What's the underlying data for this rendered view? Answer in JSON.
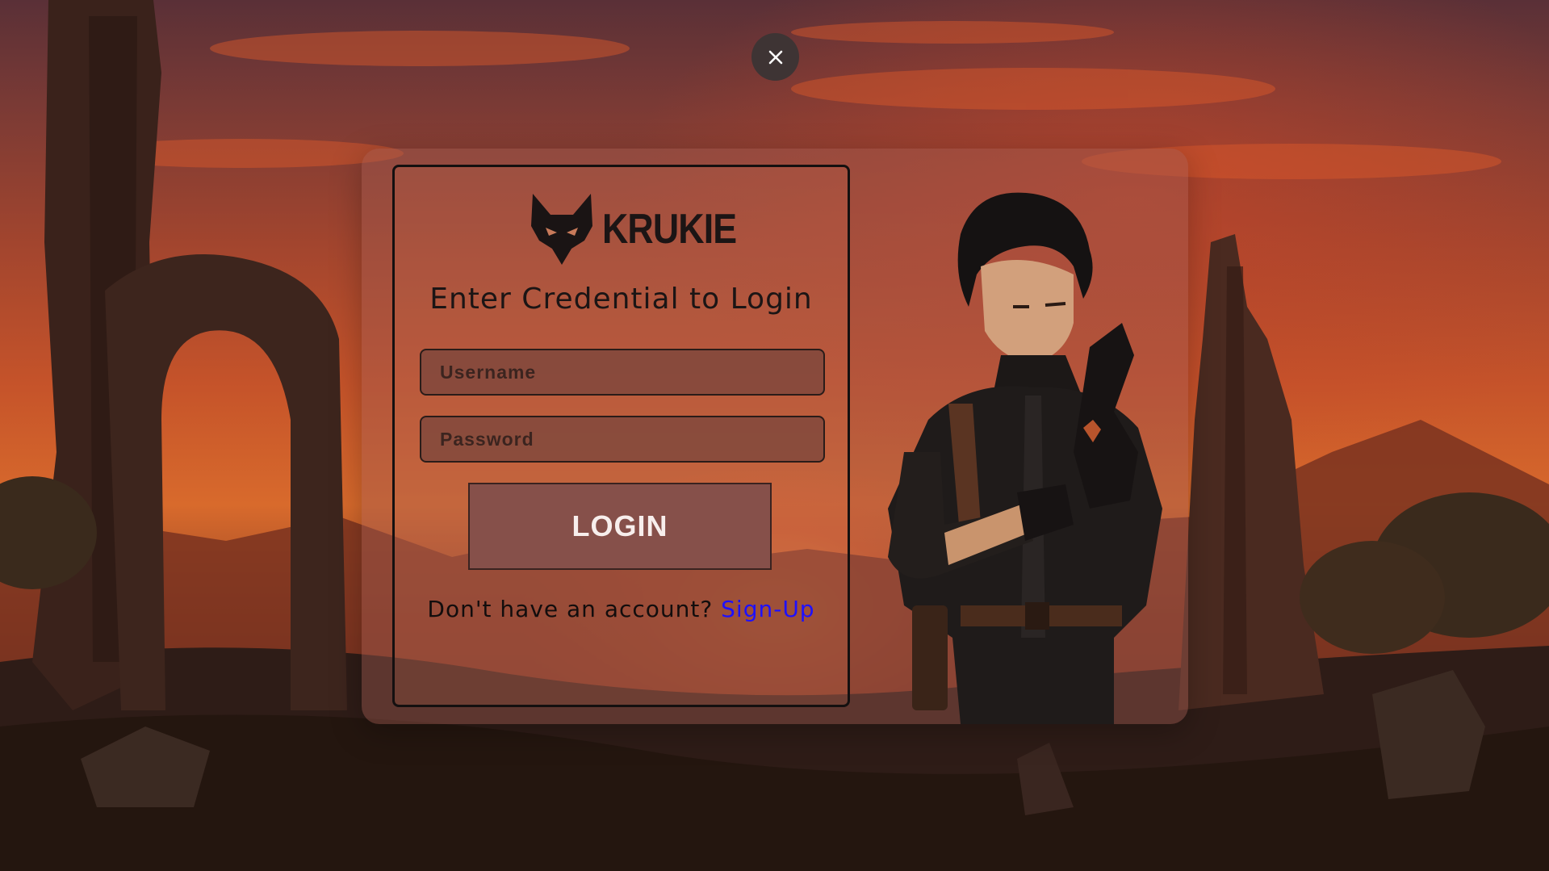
{
  "close": {
    "icon": "close-icon"
  },
  "brand": {
    "name": "KRUKIE",
    "icon": "fox-head-icon"
  },
  "form": {
    "heading": "Enter Credential to Login",
    "username_placeholder": "Username",
    "password_placeholder": "Password",
    "login_label": "LOGIN",
    "signup_prompt": "Don't have an account? ",
    "signup_link": "Sign-Up"
  },
  "colors": {
    "link": "#1e10ff",
    "button": "#86504a",
    "card_border": "#141010"
  }
}
